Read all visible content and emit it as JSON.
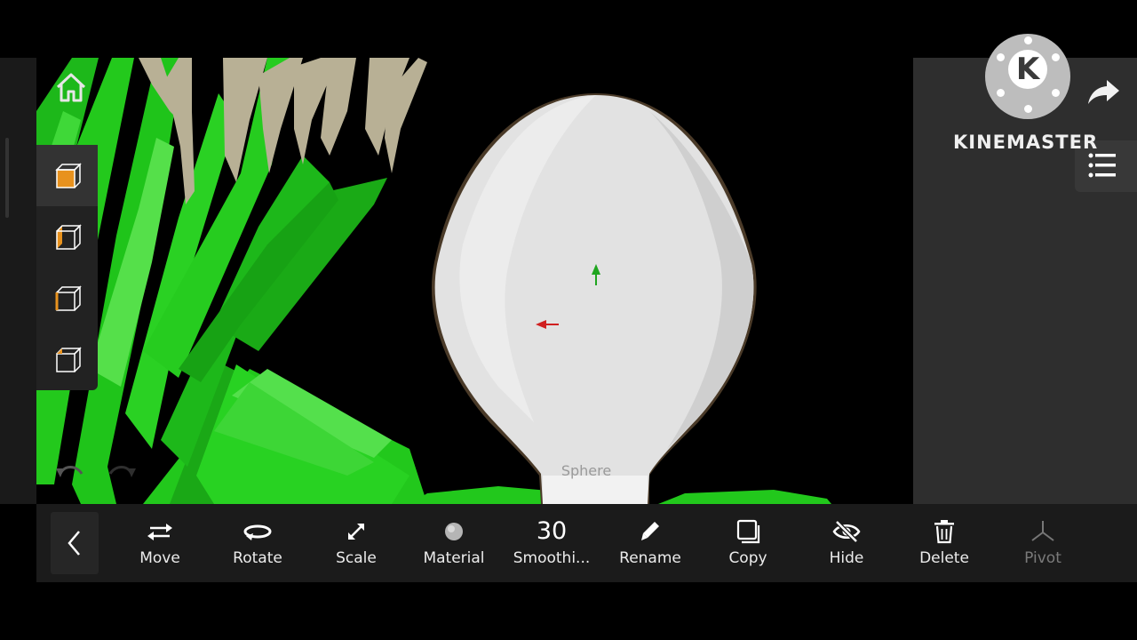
{
  "watermark": {
    "brand": "KINEMASTER",
    "logo_letter": "K"
  },
  "viewport": {
    "selected_object_label": "Sphere"
  },
  "view_panel": {
    "items": [
      "front-view",
      "right-view",
      "top-view",
      "perspective-view"
    ]
  },
  "toolbar": {
    "items": [
      {
        "label": "Move",
        "icon": "move-icon"
      },
      {
        "label": "Rotate",
        "icon": "rotate-icon"
      },
      {
        "label": "Scale",
        "icon": "scale-icon"
      },
      {
        "label": "Material",
        "icon": "material-sphere-icon"
      },
      {
        "value": "30",
        "label": "Smoothi...",
        "icon": "none"
      },
      {
        "label": "Rename",
        "icon": "pencil-icon"
      },
      {
        "label": "Copy",
        "icon": "copy-icon"
      },
      {
        "label": "Hide",
        "icon": "eye-off-icon"
      },
      {
        "label": "Delete",
        "icon": "trash-icon"
      },
      {
        "label": "Pivot",
        "icon": "pivot-icon",
        "disabled": true
      }
    ]
  },
  "colors": {
    "accent_orange": "#e8921e",
    "grass_green": "#21c21a",
    "axis_y": "#1fa51f",
    "axis_x": "#d02020"
  }
}
